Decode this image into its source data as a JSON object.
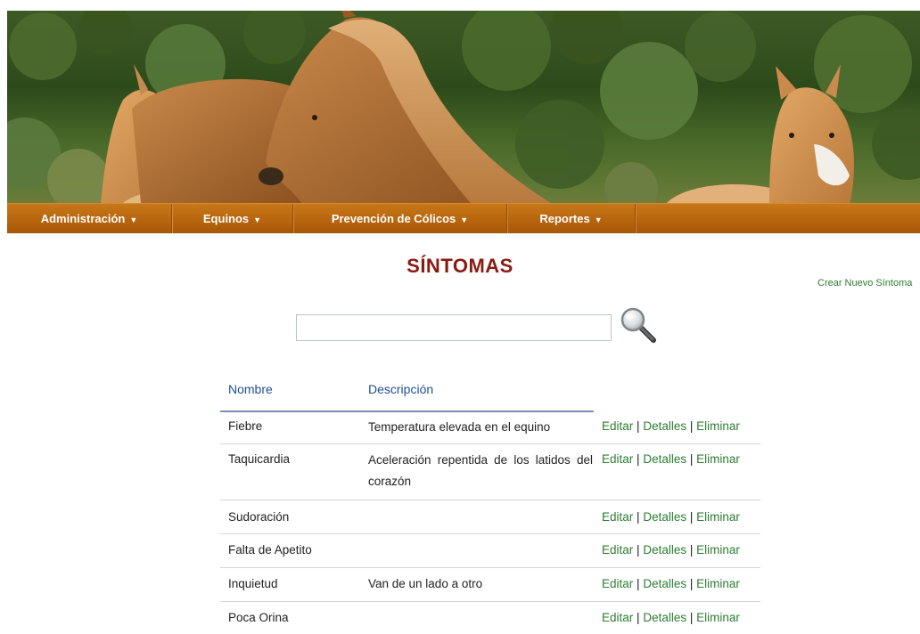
{
  "menu": {
    "items": [
      {
        "label": "Administración"
      },
      {
        "label": "Equinos"
      },
      {
        "label": "Prevención de Cólicos"
      },
      {
        "label": "Reportes"
      }
    ],
    "arrow": "▼"
  },
  "page": {
    "title": "SÍNTOMAS",
    "create_link": "Crear Nuevo Síntoma"
  },
  "search": {
    "value": "",
    "placeholder": ""
  },
  "table": {
    "headers": {
      "name": "Nombre",
      "description": "Descripción"
    },
    "action_labels": {
      "edit": "Editar",
      "details": "Detalles",
      "delete": "Eliminar",
      "separator": "|"
    },
    "rows": [
      {
        "name": "Fiebre",
        "description": "Temperatura elevada en el equino"
      },
      {
        "name": "Taquicardia",
        "description": "Aceleración repentida de los latidos del corazón"
      },
      {
        "name": "Sudoración",
        "description": ""
      },
      {
        "name": "Falta de Apetito",
        "description": ""
      },
      {
        "name": "Inquietud",
        "description": "Van de un lado a otro"
      },
      {
        "name": "Poca Orina",
        "description": ""
      }
    ]
  },
  "colors": {
    "menu_bar": "#b8650e",
    "title": "#8b1a10",
    "header_text": "#1f4e96",
    "link": "#2e7d32"
  },
  "icons": {
    "search": "magnifier-icon",
    "menu_arrow": "triangle-down-icon"
  }
}
